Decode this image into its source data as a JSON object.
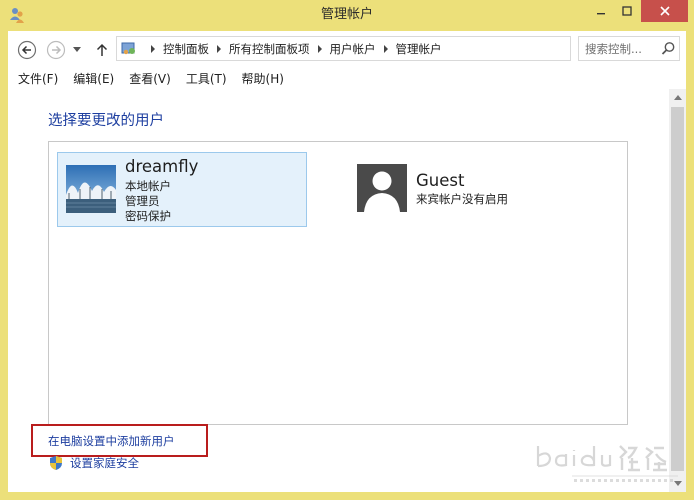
{
  "window": {
    "title": "管理帐户"
  },
  "toolbar": {
    "breadcrumbs": [
      "控制面板",
      "所有控制面板项",
      "用户帐户",
      "管理帐户"
    ],
    "search_placeholder": "搜索控制..."
  },
  "menu": {
    "items": [
      "文件(F)",
      "编辑(E)",
      "查看(V)",
      "工具(T)",
      "帮助(H)"
    ]
  },
  "main": {
    "heading": "选择要更改的用户",
    "users": [
      {
        "name": "dreamfly",
        "details": [
          "本地帐户",
          "管理员",
          "密码保护"
        ],
        "selected": true
      },
      {
        "name": "Guest",
        "details": [
          "来宾帐户没有启用"
        ],
        "selected": false
      }
    ],
    "links": {
      "add_user": "在电脑设置中添加新用户",
      "family_safety": "设置家庭安全"
    }
  },
  "colors": {
    "frame": "#ece07a",
    "link": "#1e3fa0",
    "selection_bg": "#e4f1fb",
    "selection_border": "#9cc9ec",
    "highlight_box": "#b91d1d",
    "close_button": "#c7504b"
  },
  "icons": {
    "title": "users-icon",
    "back": "arrow-left-icon",
    "forward": "arrow-right-icon",
    "recent": "chevron-down-icon",
    "up": "arrow-up-icon",
    "refresh": "refresh-icon",
    "search": "search-icon",
    "guest_avatar": "person-icon",
    "family_safety": "shield-icon"
  },
  "watermark": {
    "brand": "Baidu经验",
    "url": "jingyan.baidu.com"
  }
}
